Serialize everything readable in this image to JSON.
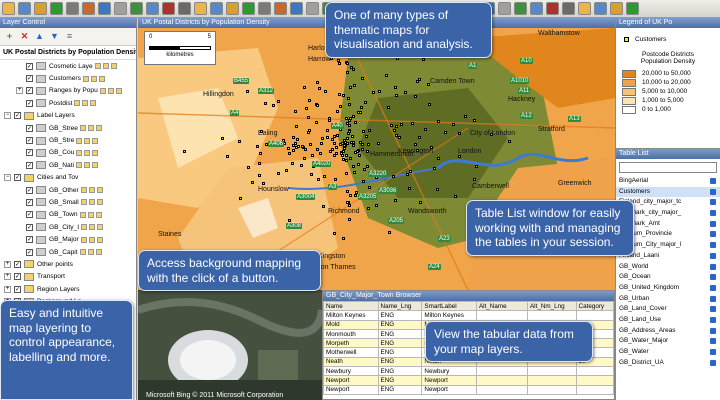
{
  "layer_control": {
    "title": "Layer Control",
    "map_name": "UK Postal Districts by Population Density",
    "layers": [
      {
        "label": "Cosmetic Laye",
        "indent": 2,
        "expand": "",
        "check": true
      },
      {
        "label": "Customers",
        "indent": 2,
        "expand": "",
        "check": true
      },
      {
        "label": "Ranges by Popu",
        "indent": 2,
        "expand": "+",
        "check": true
      },
      {
        "label": "Postdist",
        "indent": 2,
        "expand": "",
        "check": true
      },
      {
        "label": "Label Layers",
        "indent": 0,
        "expand": "−",
        "check": true
      },
      {
        "label": "GB_Stree",
        "indent": 2,
        "expand": "",
        "check": true
      },
      {
        "label": "GB_Stre",
        "indent": 2,
        "expand": "",
        "check": true
      },
      {
        "label": "GB_Cou",
        "indent": 2,
        "expand": "",
        "check": true
      },
      {
        "label": "GB_Nati",
        "indent": 2,
        "expand": "",
        "check": true
      },
      {
        "label": "Cities and Tov",
        "indent": 0,
        "expand": "−",
        "check": true
      },
      {
        "label": "GB_Other",
        "indent": 2,
        "expand": "",
        "check": true
      },
      {
        "label": "GB_Small",
        "indent": 2,
        "expand": "",
        "check": true
      },
      {
        "label": "GB_Town",
        "indent": 2,
        "expand": "",
        "check": true
      },
      {
        "label": "GB_City_I",
        "indent": 2,
        "expand": "",
        "check": true
      },
      {
        "label": "GB_Major",
        "indent": 2,
        "expand": "",
        "check": true
      },
      {
        "label": "GB_Capit",
        "indent": 2,
        "expand": "",
        "check": true
      },
      {
        "label": "Other points",
        "indent": 0,
        "expand": "+",
        "check": true
      },
      {
        "label": "Transport",
        "indent": 0,
        "expand": "+",
        "check": true
      },
      {
        "label": "Region Layers",
        "indent": 0,
        "expand": "+",
        "check": true
      },
      {
        "label": "Background La",
        "indent": 0,
        "expand": "+",
        "check": true
      }
    ]
  },
  "map_window": {
    "title": "UK Postal Districts by Population Density",
    "scale_label": "kilometres",
    "scale_ticks": [
      "0",
      "5"
    ],
    "places": [
      {
        "name": "Harlow"
      },
      {
        "name": "Waltham Cross"
      },
      {
        "name": "Walthamstow"
      },
      {
        "name": "Harrow"
      },
      {
        "name": "Hillingdon"
      },
      {
        "name": "Camden Town"
      },
      {
        "name": "Hackney"
      },
      {
        "name": "Ealing"
      },
      {
        "name": "City of London"
      },
      {
        "name": "Stratford"
      },
      {
        "name": "Hammersmith"
      },
      {
        "name": "Kensington"
      },
      {
        "name": "London"
      },
      {
        "name": "Greenwich"
      },
      {
        "name": "Hounslow"
      },
      {
        "name": "Camberwell"
      },
      {
        "name": "Wandsworth"
      },
      {
        "name": "Richmond"
      },
      {
        "name": "Staines"
      },
      {
        "name": "Kingston"
      },
      {
        "name": "upon Thames"
      }
    ],
    "roads": [
      "A312",
      "B455",
      "A4",
      "A406",
      "A40",
      "A4020",
      "A3220",
      "A205",
      "A3",
      "A3205",
      "A3036",
      "A3004",
      "A308",
      "A1",
      "A10",
      "A1010",
      "A12",
      "A11",
      "A13",
      "A23",
      "A24"
    ]
  },
  "legend": {
    "title": "Legend of UK Po",
    "customers_label": "Customers",
    "heading_line1": "Postcode Districts",
    "heading_line2": "Population Density",
    "ranges": [
      {
        "label": "20,000 to 50,000",
        "color": "#e0861c"
      },
      {
        "label": "10,000 to 20,000",
        "color": "#f0a24a"
      },
      {
        "label": "5,000 to 10,000",
        "color": "#f5c27a"
      },
      {
        "label": "1,000 to 5,000",
        "color": "#fde3b0"
      },
      {
        "label": "0 to 1,000",
        "color": "#ffffff"
      }
    ]
  },
  "table_list": {
    "title": "Table List",
    "tables": [
      "BingAerial",
      "Customers",
      "Finland_city_major_tc",
      "Denmark_city_major_",
      "Denmark_Amt",
      "Belgium_Provincie",
      "Belgium_City_major_l",
      "Finland_Laani",
      "GB_World",
      "GB_Ocean",
      "GB_United_Kingdom",
      "GB_Urban",
      "GB_Land_Cover",
      "GB_Land_Use",
      "GB_Address_Areas",
      "GB_Water_Major",
      "GB_Water",
      "GB_District_UA"
    ]
  },
  "browser": {
    "title": "GB_City_Major_Town Browser",
    "columns": [
      "Name",
      "Name_Lng",
      "SmartLabel",
      "Alt_Name",
      "Alt_Nm_Lng",
      "Category"
    ],
    "rows": [
      [
        "Milton Keynes",
        "ENG",
        "Milton Keynes",
        "",
        "",
        ""
      ],
      [
        "Mold",
        "ENG",
        "Mold",
        "Yr Wyddgrug",
        "WEL",
        "150"
      ],
      [
        "Monmouth",
        "ENG",
        "Monmouth",
        "Trefynwy",
        "WEL",
        "50"
      ],
      [
        "Morpeth",
        "ENG",
        "Morpeth",
        "",
        "",
        "50"
      ],
      [
        "Motherwell",
        "ENG",
        "Motherwell",
        "",
        "",
        "150"
      ],
      [
        "Neath",
        "ENG",
        "Neath",
        "",
        "",
        "50"
      ],
      [
        "Newbury",
        "ENG",
        "Newbury",
        "",
        "",
        ""
      ],
      [
        "Newport",
        "ENG",
        "Newport",
        "",
        "",
        ""
      ],
      [
        "Newport",
        "ENG",
        "Newport",
        "",
        "",
        ""
      ]
    ]
  },
  "aerial": {
    "credit": "Microsoft Bing © 2011 Microsoft Corporation"
  },
  "callouts": {
    "thematic": "One of many types of thematic maps for visualisation and analysis.",
    "tablelist": "Table List window for easily working with and managing the tables in your session.",
    "background": "Access background mapping with the click of a button.",
    "layering": "Easy and intuitive map layering to control appearance, labelling and more.",
    "tabular": "View the tabular data from your map layers."
  },
  "colors": {
    "accent": "#3a63a8",
    "point": "#ffec00",
    "density_high": "#6b7a2a"
  }
}
